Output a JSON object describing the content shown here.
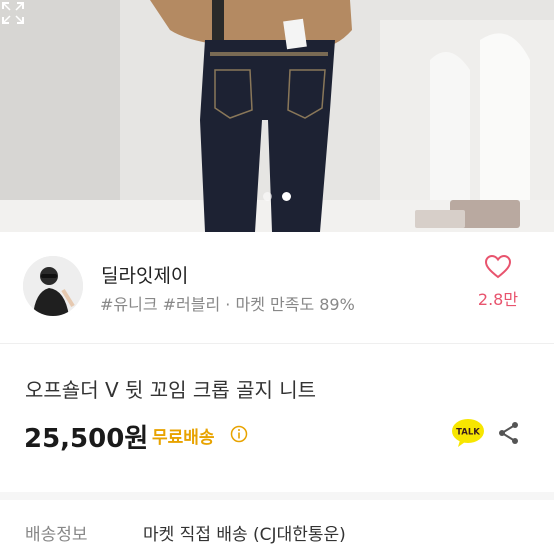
{
  "carousel": {
    "page_count": 2,
    "active_index": 1
  },
  "seller": {
    "name": "딜라잇제이",
    "meta": "#유니크 #러블리 · 마켓 만족도 89%",
    "like_count": "2.8만"
  },
  "product": {
    "title": "오프숄더 V 뒷 꼬임 크롭 골지 니트",
    "price": "25,500원",
    "shipping_tag": "무료배송"
  },
  "shipping": {
    "label": "배송정보",
    "value": "마켓 직접 배송 (CJ대한통운)"
  },
  "icons": {
    "expand": "expand-icon",
    "heart": "heart-icon",
    "info": "info-icon",
    "talk": "kakao-talk-icon",
    "share": "share-icon"
  },
  "colors": {
    "accent_pink": "#e8546e",
    "shipping_yellow": "#e8a300",
    "talk_yellow": "#f7e600"
  }
}
